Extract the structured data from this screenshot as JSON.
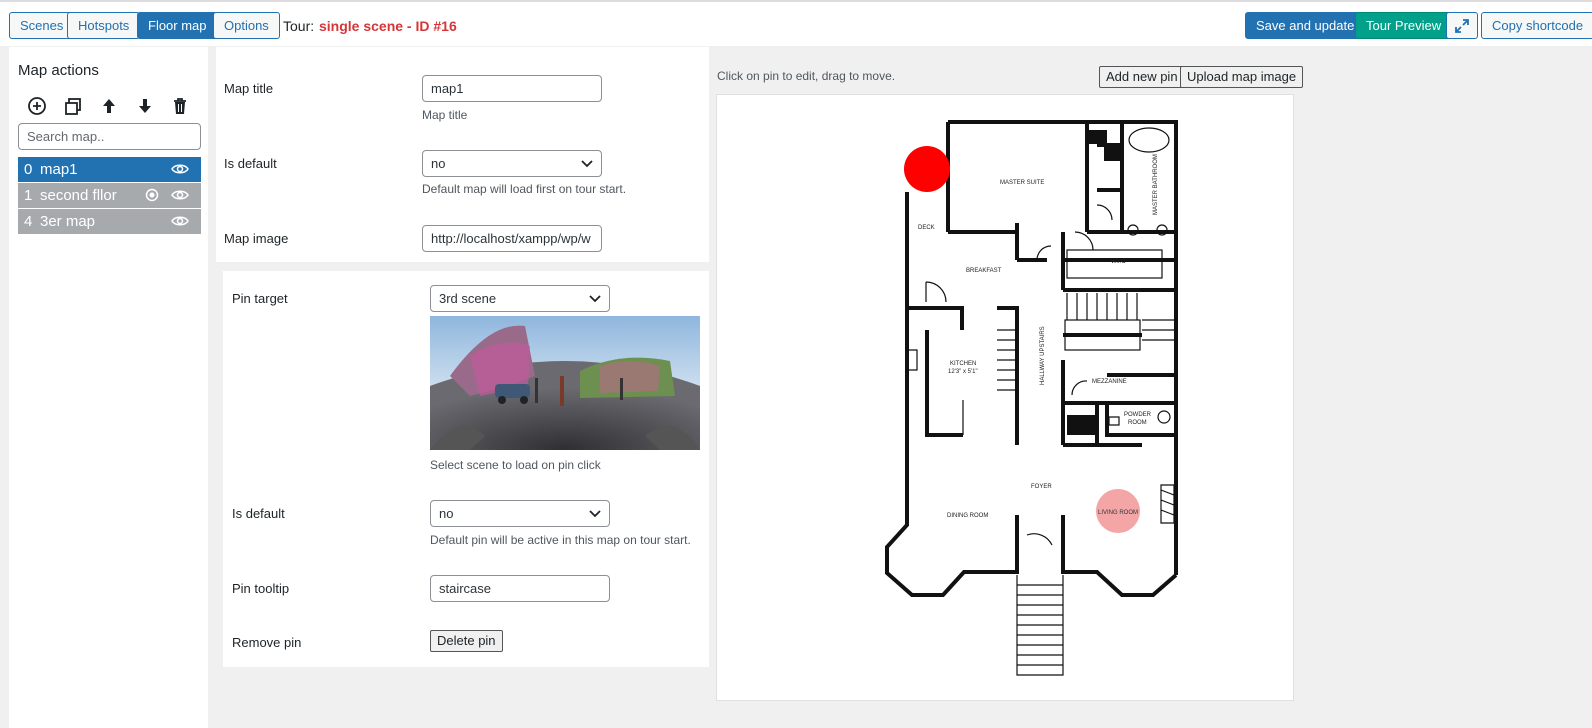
{
  "toolbar": {
    "tabs": [
      {
        "label": "Scenes",
        "active": false
      },
      {
        "label": "Hotspots",
        "active": false
      },
      {
        "label": "Floor map",
        "active": true
      },
      {
        "label": "Options",
        "active": false
      }
    ],
    "tour_label": "Tour:",
    "tour_title": "single scene - ID #16",
    "save_label": "Save and update",
    "preview_label": "Tour Preview",
    "fullscreen_icon": "expand-icon",
    "copy_label": "Copy shortcode"
  },
  "sidebar": {
    "heading": "Map actions",
    "actions": [
      "add-circle-icon",
      "duplicate-icon",
      "arrow-up-icon",
      "arrow-down-icon",
      "trash-icon"
    ],
    "search_placeholder": "Search map..",
    "maps": [
      {
        "index": "0",
        "name": "map1",
        "selected": true
      },
      {
        "index": "1",
        "name": "second fllor",
        "selected": false
      },
      {
        "index": "4",
        "name": "3er map",
        "selected": false
      }
    ]
  },
  "form": {
    "map_title_label": "Map title",
    "map_title_value": "map1",
    "map_title_help": "Map title",
    "is_default_label": "Is default",
    "is_default_value": "no",
    "is_default_help": "Default map will load first on tour start.",
    "map_image_label": "Map image",
    "map_image_value": "http://localhost/xampp/wp/w"
  },
  "pin": {
    "target_label": "Pin target",
    "target_value": "3rd scene",
    "target_help": "Select scene to load on pin click",
    "is_default_label": "Is default",
    "is_default_value": "no",
    "is_default_help": "Default pin will be active in this map on tour start.",
    "tooltip_label": "Pin tooltip",
    "tooltip_value": "staircase",
    "remove_label": "Remove pin",
    "delete_label": "Delete pin"
  },
  "map": {
    "hint": "Click on pin to edit, drag to move.",
    "add_pin_label": "Add new pin",
    "upload_label": "Upload map image",
    "rooms": {
      "master_suite": "MASTER SUITE",
      "master_bathroom": "MASTER BATHROOM",
      "deck": "DECK",
      "breakfast": "BREAKFAST",
      "wic": "W.I.C",
      "kitchen": "KITCHEN",
      "kitchen_dim": "12'3\" x 5'1\"",
      "hallway": "HALLWAY UPSTAIRS",
      "mezzanine": "MEZZANINE",
      "powder": "POWDER",
      "powder2": "ROOM",
      "foyer": "FOYER",
      "dining": "DINING ROOM",
      "living": "LIVING ROOM"
    },
    "colors": {
      "active_pin": "#ff0000",
      "inactive_pin": "#f4a6a6"
    }
  }
}
